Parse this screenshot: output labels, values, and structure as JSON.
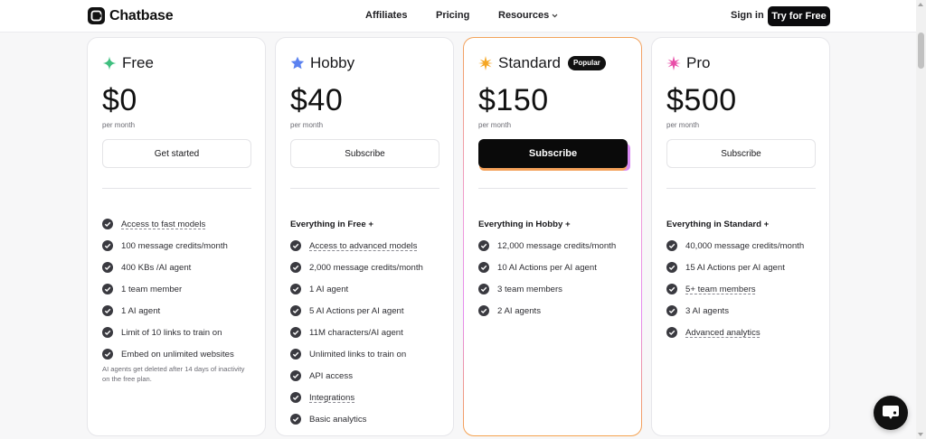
{
  "header": {
    "brand": "Chatbase",
    "nav": {
      "affiliates": "Affiliates",
      "pricing": "Pricing",
      "resources": "Resources"
    },
    "sign_in": "Sign in",
    "try_free": "Try for Free"
  },
  "colors": {
    "free_icon": "#3fbf7f",
    "hobby_icon": "#5b82f0",
    "standard_icon": "#f5a623",
    "pro_icon": "#e94ea8"
  },
  "plans": [
    {
      "name": "Free",
      "icon": "sparkle-icon",
      "price": "$0",
      "period": "per month",
      "cta": "Get started",
      "features": [
        "Access to fast models",
        "100 message credits/month",
        "400 KBs /AI agent",
        "1 team member",
        "1 AI agent",
        "Limit of 10 links to train on",
        "Embed on unlimited websites"
      ],
      "note": "AI agents get deleted after 14 days of inactivity on the free plan."
    },
    {
      "name": "Hobby",
      "icon": "star-icon",
      "price": "$40",
      "period": "per month",
      "cta": "Subscribe",
      "heading": "Everything in Free +",
      "features": [
        "Access to advanced models",
        "2,000 message credits/month",
        "1 AI agent",
        "5 AI Actions per AI agent",
        "11M characters/AI agent",
        "Unlimited links to train on",
        "API access",
        "Integrations",
        "Basic analytics"
      ]
    },
    {
      "name": "Standard",
      "icon": "burst-icon",
      "badge": "Popular",
      "price": "$150",
      "period": "per month",
      "cta": "Subscribe",
      "heading": "Everything in Hobby +",
      "features": [
        "12,000 message credits/month",
        "10 AI Actions per AI agent",
        "3 team members",
        "2 AI agents"
      ]
    },
    {
      "name": "Pro",
      "icon": "burst-icon",
      "price": "$500",
      "period": "per month",
      "cta": "Subscribe",
      "heading": "Everything in Standard +",
      "features": [
        "40,000 message credits/month",
        "15 AI Actions per AI agent",
        "5+ team members",
        "3 AI agents",
        "Advanced analytics"
      ]
    }
  ]
}
